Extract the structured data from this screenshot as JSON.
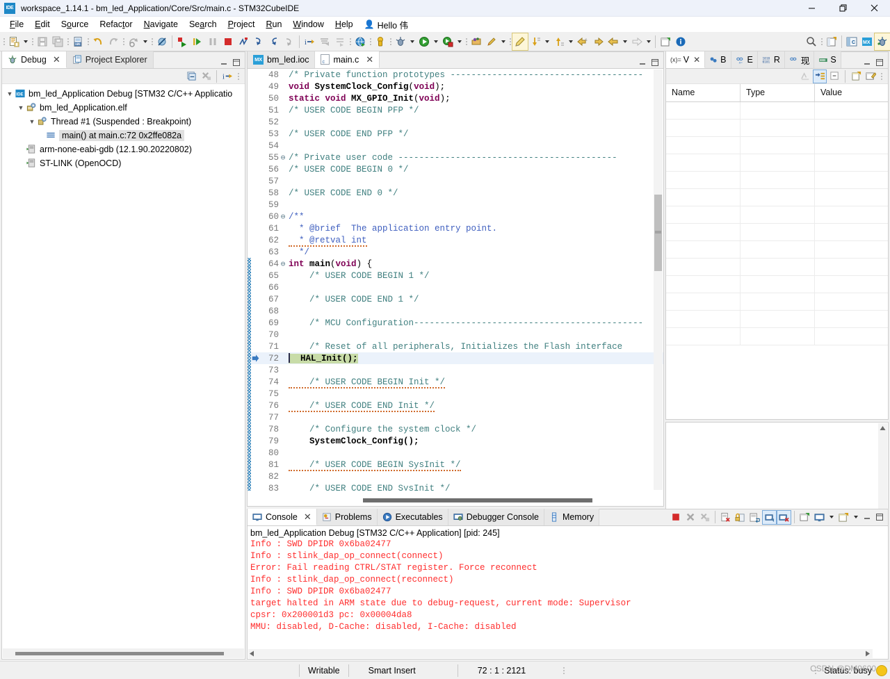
{
  "window": {
    "title": "workspace_1.14.1 - bm_led_Application/Core/Src/main.c - STM32CubeIDE",
    "app_icon": "ide-icon",
    "controls": {
      "minimize": "minimize-icon",
      "restore": "restore-icon",
      "close": "close-icon"
    }
  },
  "menu": {
    "items": [
      {
        "label": "File"
      },
      {
        "label": "Edit"
      },
      {
        "label": "Source"
      },
      {
        "label": "Refactor"
      },
      {
        "label": "Navigate"
      },
      {
        "label": "Search"
      },
      {
        "label": "Project"
      },
      {
        "label": "Run"
      },
      {
        "label": "Window"
      },
      {
        "label": "Help"
      }
    ],
    "user": {
      "label": "Hello 伟",
      "icon": "person-icon"
    }
  },
  "toolbar": {
    "items": [
      "new-icon",
      "dropdown",
      "sep",
      "save-icon",
      "save-all-icon",
      "sep",
      "new-c-file-icon",
      "sep",
      "undo-icon",
      "redo-icon",
      "sep",
      "build-icon",
      "dropdown",
      "sep",
      "debug-skip-icon",
      "sep",
      "resume-icon",
      "step-into-icon",
      "suspend-icon",
      "terminate-icon",
      "disconnect-icon",
      "step-over-icon",
      "step-return-icon",
      "step-out-icon",
      "sep",
      "instruction-step-icon",
      "use-step-filters-icon",
      "drop-to-frame-icon",
      "sep",
      "open-web-icon",
      "sep",
      "pin-icon",
      "sep",
      "external-tools-icon",
      "dropdown",
      "run-icon",
      "dropdown",
      "debug-launch-icon",
      "dropdown",
      "sep",
      "open-type-icon",
      "search-ref-icon",
      "dropdown",
      "pencil-highlight-icon",
      "next-annotation-icon",
      "dropdown",
      "prev-annotation-icon",
      "dropdown",
      "back-nav-icon",
      "forward-nav-icon",
      "prev-edit-icon",
      "dropdown",
      "next-edit-icon",
      "dropdown",
      "sep",
      "new-window-icon",
      "info-icon"
    ],
    "right_items": [
      "search-icon",
      "sep",
      "new-perspective-icon",
      "sep",
      "c-perspective-icon",
      "mx-perspective-icon",
      "debug-perspective-icon"
    ]
  },
  "left_panel": {
    "tabs": [
      {
        "label": "Debug",
        "icon": "debug-icon",
        "active": true,
        "closeable": true
      },
      {
        "label": "Project Explorer",
        "icon": "project-explorer-icon",
        "active": false,
        "closeable": false
      }
    ],
    "view_toolbar": [
      "collapse-all-icon",
      "remove-all-terminated-icon",
      "sep",
      "step-into-selection-icon",
      "view-menu-icon"
    ],
    "panel_controls": [
      "minimize-icon",
      "maximize-icon"
    ],
    "tree": [
      {
        "indent": 0,
        "twisty": "expanded",
        "icon": "ide-launch-icon",
        "label": "bm_led_Application Debug [STM32 C/C++ Applicatio",
        "selected": false
      },
      {
        "indent": 1,
        "twisty": "expanded",
        "icon": "process-icon",
        "label": "bm_led_Application.elf",
        "selected": false
      },
      {
        "indent": 2,
        "twisty": "expanded",
        "icon": "thread-icon",
        "label": "Thread #1 (Suspended : Breakpoint)",
        "selected": false
      },
      {
        "indent": 3,
        "twisty": "none",
        "icon": "stackframe-icon",
        "label": "main() at main.c:72 0x2ffe082a",
        "selected": true
      },
      {
        "indent": 1,
        "twisty": "none",
        "icon": "gdb-icon",
        "label": "arm-none-eabi-gdb (12.1.90.20220802)",
        "selected": false
      },
      {
        "indent": 1,
        "twisty": "none",
        "icon": "gdb-icon",
        "label": "ST-LINK (OpenOCD)",
        "selected": false
      }
    ]
  },
  "editor": {
    "tabs": [
      {
        "label": "bm_led.ioc",
        "icon": "mx-file-icon",
        "active": false,
        "closeable": false
      },
      {
        "label": "main.c",
        "icon": "c-file-icon",
        "active": true,
        "closeable": true
      }
    ],
    "panel_controls": [
      "minimize-icon",
      "maximize-icon"
    ],
    "current_line": 72,
    "lines": [
      {
        "n": 48,
        "fold": "",
        "changed": false,
        "tokens": [
          {
            "t": "/* Private function prototypes -------------------------------------",
            "c": "cm"
          }
        ]
      },
      {
        "n": 49,
        "fold": "",
        "changed": false,
        "tokens": [
          {
            "t": "void ",
            "c": "kw"
          },
          {
            "t": "SystemClock_Config",
            "c": "fn"
          },
          {
            "t": "(",
            "c": "pl"
          },
          {
            "t": "void",
            "c": "kw"
          },
          {
            "t": ");",
            "c": "pl"
          }
        ]
      },
      {
        "n": 50,
        "fold": "",
        "changed": false,
        "tokens": [
          {
            "t": "static void ",
            "c": "kw"
          },
          {
            "t": "MX_GPIO_Init",
            "c": "fn"
          },
          {
            "t": "(",
            "c": "pl"
          },
          {
            "t": "void",
            "c": "kw"
          },
          {
            "t": ");",
            "c": "pl"
          }
        ]
      },
      {
        "n": 51,
        "fold": "",
        "changed": false,
        "tokens": [
          {
            "t": "/* USER CODE BEGIN PFP */",
            "c": "cm"
          }
        ]
      },
      {
        "n": 52,
        "fold": "",
        "changed": false,
        "tokens": []
      },
      {
        "n": 53,
        "fold": "",
        "changed": false,
        "tokens": [
          {
            "t": "/* USER CODE END PFP */",
            "c": "cm"
          }
        ]
      },
      {
        "n": 54,
        "fold": "",
        "changed": false,
        "tokens": []
      },
      {
        "n": 55,
        "fold": "collapse",
        "changed": false,
        "tokens": [
          {
            "t": "/* Private user code ------------------------------------------",
            "c": "cm"
          }
        ]
      },
      {
        "n": 56,
        "fold": "",
        "changed": false,
        "tokens": [
          {
            "t": "/* USER CODE BEGIN 0 */",
            "c": "cm"
          }
        ]
      },
      {
        "n": 57,
        "fold": "",
        "changed": false,
        "tokens": []
      },
      {
        "n": 58,
        "fold": "",
        "changed": false,
        "tokens": [
          {
            "t": "/* USER CODE END 0 */",
            "c": "cm"
          }
        ]
      },
      {
        "n": 59,
        "fold": "",
        "changed": false,
        "tokens": []
      },
      {
        "n": 60,
        "fold": "collapse",
        "changed": false,
        "tokens": [
          {
            "t": "/**",
            "c": "jd"
          }
        ]
      },
      {
        "n": 61,
        "fold": "",
        "changed": false,
        "tokens": [
          {
            "t": "  * @brief  The application entry point.",
            "c": "jd"
          }
        ]
      },
      {
        "n": 62,
        "fold": "",
        "changed": false,
        "tokens": [
          {
            "t": "  * @retval int",
            "c": "jd"
          }
        ]
      },
      {
        "n": 63,
        "fold": "",
        "changed": false,
        "tokens": [
          {
            "t": "  */",
            "c": "jd"
          }
        ]
      },
      {
        "n": 64,
        "fold": "collapse",
        "changed": true,
        "tokens": [
          {
            "t": "int ",
            "c": "kw"
          },
          {
            "t": "main",
            "c": "fn"
          },
          {
            "t": "(",
            "c": "pl"
          },
          {
            "t": "void",
            "c": "kw"
          },
          {
            "t": ") {",
            "c": "pl"
          }
        ]
      },
      {
        "n": 65,
        "fold": "",
        "changed": true,
        "tokens": [
          {
            "t": "    /* USER CODE BEGIN 1 */",
            "c": "cm"
          }
        ]
      },
      {
        "n": 66,
        "fold": "",
        "changed": true,
        "tokens": []
      },
      {
        "n": 67,
        "fold": "",
        "changed": true,
        "tokens": [
          {
            "t": "    /* USER CODE END 1 */",
            "c": "cm"
          }
        ]
      },
      {
        "n": 68,
        "fold": "",
        "changed": true,
        "tokens": []
      },
      {
        "n": 69,
        "fold": "",
        "changed": true,
        "tokens": [
          {
            "t": "    /* MCU Configuration--------------------------------------------",
            "c": "cm"
          }
        ]
      },
      {
        "n": 70,
        "fold": "",
        "changed": true,
        "tokens": []
      },
      {
        "n": 71,
        "fold": "",
        "changed": true,
        "tokens": [
          {
            "t": "    /* Reset of all peripherals, Initializes the Flash interface",
            "c": "cm"
          }
        ]
      },
      {
        "n": 72,
        "fold": "",
        "changed": true,
        "exec": true,
        "marker": "instruction-pointer",
        "tokens": [
          {
            "t": "  HAL_Init();",
            "c": "fn"
          }
        ]
      },
      {
        "n": 73,
        "fold": "",
        "changed": true,
        "tokens": []
      },
      {
        "n": 74,
        "fold": "",
        "changed": true,
        "tokens": [
          {
            "t": "    /* USER CODE BEGIN Init */",
            "c": "cm"
          }
        ]
      },
      {
        "n": 75,
        "fold": "",
        "changed": true,
        "tokens": []
      },
      {
        "n": 76,
        "fold": "",
        "changed": true,
        "tokens": [
          {
            "t": "    /* USER CODE END Init */",
            "c": "cm"
          }
        ]
      },
      {
        "n": 77,
        "fold": "",
        "changed": true,
        "tokens": []
      },
      {
        "n": 78,
        "fold": "",
        "changed": true,
        "tokens": [
          {
            "t": "    /* Configure the system clock */",
            "c": "cm"
          }
        ]
      },
      {
        "n": 79,
        "fold": "",
        "changed": true,
        "tokens": [
          {
            "t": "    SystemClock_Config();",
            "c": "fn"
          }
        ]
      },
      {
        "n": 80,
        "fold": "",
        "changed": true,
        "tokens": []
      },
      {
        "n": 81,
        "fold": "",
        "changed": true,
        "tokens": [
          {
            "t": "    /* USER CODE BEGIN SysInit */",
            "c": "cm"
          }
        ]
      },
      {
        "n": 82,
        "fold": "",
        "changed": true,
        "tokens": []
      },
      {
        "n": 83,
        "fold": "",
        "changed": true,
        "tokens": [
          {
            "t": "    /* USER CODE END SysInit */",
            "c": "cm"
          }
        ]
      }
    ]
  },
  "variables_panel": {
    "tabs": [
      {
        "label": "V",
        "icon": "variables-icon",
        "active": true,
        "closeable": true
      },
      {
        "label": "B",
        "icon": "breakpoints-icon",
        "active": false
      },
      {
        "label": "E",
        "icon": "expressions-icon",
        "active": false
      },
      {
        "label": "R",
        "icon": "registers-icon",
        "active": false
      },
      {
        "label": "现",
        "icon": "live-expressions-icon",
        "active": false
      },
      {
        "label": "S",
        "icon": "sfrs-icon",
        "active": false
      }
    ],
    "toolbar": [
      "collapse-all-icon",
      "show-type-names-icon",
      "collapse-icon",
      "sep",
      "new-expression-icon",
      "edit-value-icon",
      "view-menu-icon"
    ],
    "panel_controls": [
      "minimize-icon",
      "maximize-icon"
    ],
    "columns": [
      "Name",
      "Type",
      "Value"
    ],
    "rows": []
  },
  "console": {
    "tabs": [
      {
        "label": "Console",
        "icon": "console-icon",
        "active": true,
        "closeable": true
      },
      {
        "label": "Problems",
        "icon": "problems-icon",
        "active": false
      },
      {
        "label": "Executables",
        "icon": "executables-icon",
        "active": false
      },
      {
        "label": "Debugger Console",
        "icon": "debugger-console-icon",
        "active": false
      },
      {
        "label": "Memory",
        "icon": "memory-icon",
        "active": false
      }
    ],
    "toolbar": [
      "terminate-icon",
      "remove-launch-icon",
      "remove-all-terminated-icon",
      "sep",
      "clear-console-icon",
      "scroll-lock-icon",
      "word-wrap-icon",
      "show-console-on-output-icon",
      "show-console-on-error-icon",
      "sep",
      "pin-console-icon",
      "display-selected-console-icon",
      "dropdown",
      "open-console-icon",
      "dropdown"
    ],
    "panel_controls": [
      "minimize-icon",
      "maximize-icon"
    ],
    "header": "bm_led_Application Debug [STM32 C/C++ Application]  [pid: 245]",
    "output": [
      {
        "text": "Info : SWD DPIDR 0x6ba02477",
        "color": "red"
      },
      {
        "text": "Info : stlink_dap_op_connect(connect)",
        "color": "red"
      },
      {
        "text": "Error: Fail reading CTRL/STAT register. Force reconnect",
        "color": "red"
      },
      {
        "text": "Info : stlink_dap_op_connect(reconnect)",
        "color": "red"
      },
      {
        "text": "Info : SWD DPIDR 0x6ba02477",
        "color": "red"
      },
      {
        "text": "target halted in ARM state due to debug-request, current mode: Supervisor",
        "color": "red"
      },
      {
        "text": "cpsr: 0x200001d3 pc: 0x00004da8",
        "color": "red"
      },
      {
        "text": "MMU: disabled, D-Cache: disabled, I-Cache: disabled",
        "color": "red"
      }
    ]
  },
  "statusbar": {
    "writable": "Writable",
    "insert_mode": "Smart Insert",
    "position": "72 : 1 : 2121",
    "status": "Status: busy",
    "watermark": "CSDN @DM9600"
  },
  "colors": {
    "accent": "#2a7fb8",
    "exec_line": "#c8dca8",
    "current_line": "#ebf2fb",
    "comment": "#3f7f7f",
    "keyword": "#7f0055",
    "javadoc": "#3f5fbf",
    "error_text": "#ff2d2d",
    "titlebar": "#eef2fa"
  }
}
